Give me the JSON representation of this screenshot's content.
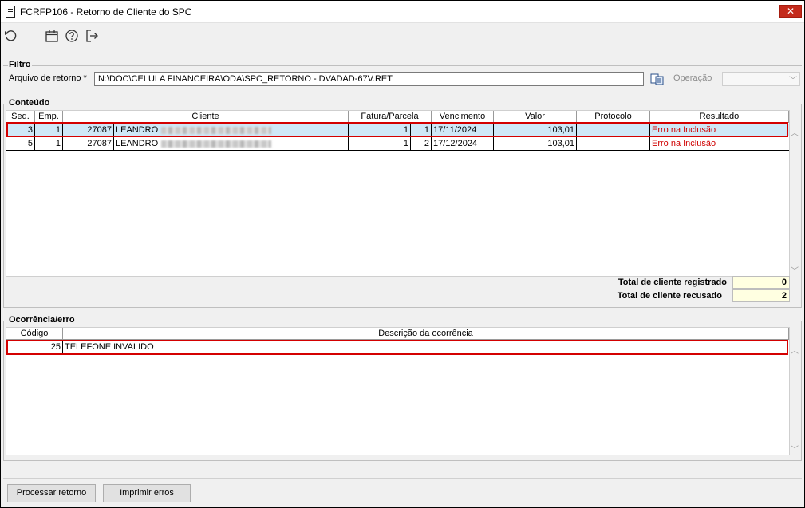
{
  "window": {
    "title": "FCRFP106 - Retorno de Cliente do SPC",
    "close_glyph": "✕"
  },
  "toolbar": {
    "icons": [
      "undo-icon",
      "calendar-icon",
      "help-icon",
      "exit-icon"
    ]
  },
  "filter": {
    "group_label": "Filtro",
    "file_label": "Arquivo de retorno *",
    "file_value": "N:\\DOC\\CELULA FINANCEIRA\\ODA\\SPC_RETORNO - DVADAD-67V.RET",
    "operation_label": "Operação",
    "operation_value": ""
  },
  "content": {
    "group_label": "Conteúdo",
    "columns": [
      "Seq.",
      "Emp.",
      "Cliente",
      "Fatura/Parcela",
      "Vencimento",
      "Valor",
      "Protocolo",
      "Resultado"
    ],
    "rows": [
      {
        "seq": "3",
        "emp": "1",
        "client_code": "27087",
        "client_name": "LEANDRO",
        "fatura": "1",
        "parcela": "1",
        "vencimento": "17/11/2024",
        "valor": "103,01",
        "protocolo": "",
        "resultado": "Erro na Inclusão"
      },
      {
        "seq": "5",
        "emp": "1",
        "client_code": "27087",
        "client_name": "LEANDRO",
        "fatura": "1",
        "parcela": "2",
        "vencimento": "17/12/2024",
        "valor": "103,01",
        "protocolo": "",
        "resultado": "Erro na Inclusão"
      }
    ],
    "totals": {
      "registered_label": "Total de cliente registrado",
      "registered_value": "0",
      "refused_label": "Total de cliente recusado",
      "refused_value": "2"
    }
  },
  "occurrence": {
    "group_label": "Ocorrência/erro",
    "columns": [
      "Código",
      "Descrição da ocorrência"
    ],
    "rows": [
      {
        "codigo": "25",
        "descricao": "TELEFONE INVALIDO"
      }
    ]
  },
  "buttons": {
    "process_label": "Processar retorno",
    "print_label": "Imprimir erros"
  },
  "colors": {
    "highlight": "#d40000",
    "selected_row": "#cfe8f7",
    "error_text": "#d00000",
    "total_box": "#ffffe1"
  }
}
